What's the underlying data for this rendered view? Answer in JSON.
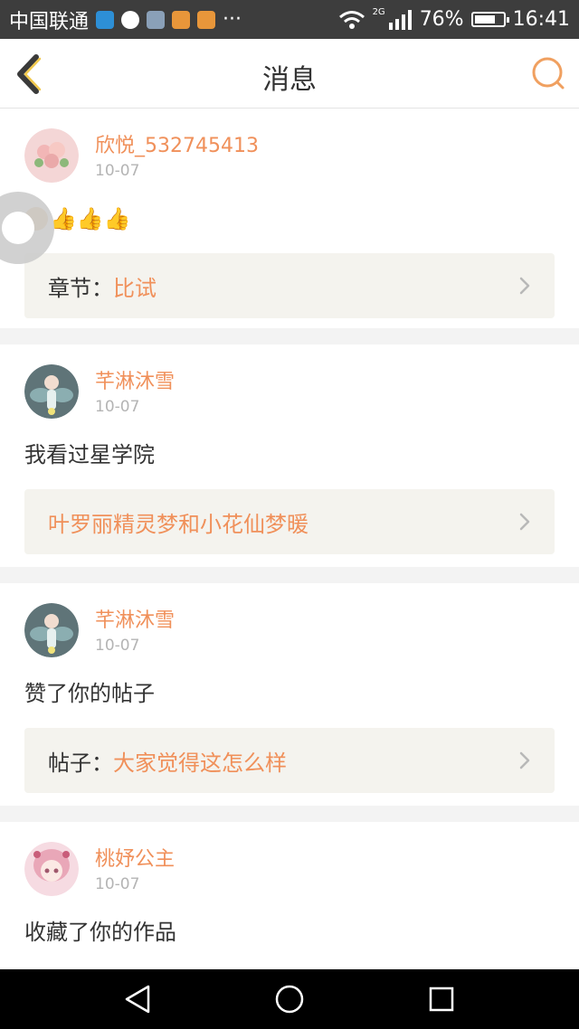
{
  "status_bar": {
    "carrier": "中国联通",
    "ellipsis": "···",
    "network": "2G",
    "battery": "76%",
    "battery_level": 0.76,
    "time": "16:41"
  },
  "header": {
    "title": "消息",
    "back_icon": "chevron-left-icon",
    "search_icon": "search-icon"
  },
  "messages": [
    {
      "username": "欣悦_532745413",
      "date": "10-07",
      "text": "👍👍👍",
      "ref_key": "章节：",
      "ref_value": "比试"
    },
    {
      "username": "芊淋沐雪",
      "date": "10-07",
      "text": "我看过星学院",
      "ref_key": "",
      "ref_value": "叶罗丽精灵梦和小花仙梦暖"
    },
    {
      "username": "芊淋沐雪",
      "date": "10-07",
      "text": "赞了你的帖子",
      "ref_key": "帖子：",
      "ref_value": "大家觉得这怎么样"
    },
    {
      "username": "桃妤公主",
      "date": "10-07",
      "text": "收藏了你的作品"
    }
  ],
  "colors": {
    "accent": "#f0905a",
    "ref_bg": "#f4f3ee",
    "status_bar": "#3d3d3d"
  },
  "nav": {
    "back": "triangle-back-icon",
    "home": "circle-home-icon",
    "recents": "square-recents-icon"
  }
}
